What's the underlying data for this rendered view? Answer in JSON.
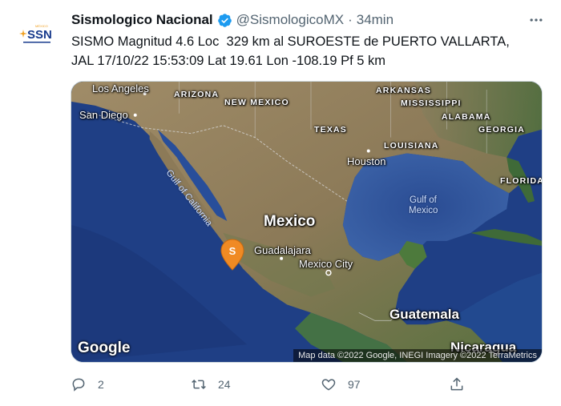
{
  "tweet": {
    "display_name": "Sismologico Nacional",
    "handle": "@SismologicoMX",
    "separator": "·",
    "time": "34min",
    "text": "SISMO Magnitud 4.6 Loc  329 km al SUROESTE de PUERTO VALLARTA,\nJAL 17/10/22 15:53:09 Lat 19.61 Lon -108.19 Pf 5 km",
    "avatar": {
      "label": "SSN",
      "small": "MÉXICO"
    }
  },
  "map": {
    "labels": {
      "los_angeles": "Los Angeles",
      "san_diego": "San Diego",
      "arizona": "ARIZONA",
      "new_mexico": "NEW MEXICO",
      "texas": "TEXAS",
      "arkansas": "ARKANSAS",
      "mississippi": "MISSISSIPPI",
      "alabama": "ALABAMA",
      "georgia": "GEORGIA",
      "louisiana": "LOUISIANA",
      "florida": "FLORIDA",
      "houston": "Houston",
      "gulf_of_california": "Gulf of California",
      "gulf_of_mexico_1": "Gulf of",
      "gulf_of_mexico_2": "Mexico",
      "mexico": "Mexico",
      "guadalajara": "Guadalajara",
      "mexico_city": "Mexico City",
      "guatemala": "Guatemala",
      "nicaragua": "Nicaragua"
    },
    "pin_letter": "S",
    "google_logo": "Google",
    "attribution": "Map data ©2022 Google, INEGI Imagery ©2022 TerraMetrics"
  },
  "actions": {
    "reply_count": "2",
    "retweet_count": "24",
    "like_count": "97"
  },
  "colors": {
    "verified": "#1d9bf0",
    "pin": "#f08a24",
    "ocean": "#1d3f86",
    "avatar_blue": "#173a8c",
    "avatar_orange": "#f0a020"
  }
}
